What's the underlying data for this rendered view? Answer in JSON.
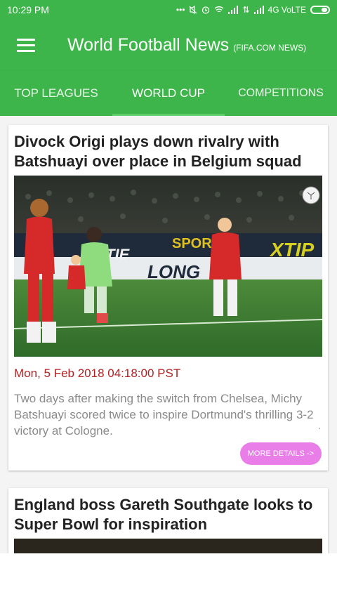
{
  "status_bar": {
    "time": "10:29 PM",
    "network": "4G VoLTE"
  },
  "app_bar": {
    "title": "World Football News",
    "subtitle": "(FIFA.COM NEWS)"
  },
  "tabs": [
    {
      "label": "TOP LEAGUES",
      "active": false
    },
    {
      "label": "WORLD CUP",
      "active": true
    },
    {
      "label": "COMPETITIONS",
      "active": false
    }
  ],
  "articles": [
    {
      "title": "Divock Origi plays down rivalry with Batshuayi over place in Belgium squad",
      "date": "Mon, 5 Feb 2018 04:18:00 PST",
      "excerpt": "Two days after making the switch from Chelsea, Michy Batshuayi scored twice to inspire Dortmund's thrilling 3-2 victory at Cologne.",
      "more_label": "MORE DETAILS ->"
    },
    {
      "title": "England boss Gareth Southgate looks to Super Bowl for inspiration"
    }
  ],
  "photo_text": {
    "board_1": "SPORT",
    "board_2": "XTIP",
    "board_3": "TIE",
    "banner": "LONG"
  },
  "colors": {
    "primary": "#3eb54a",
    "accent": "#e97ee8",
    "date": "#b22222"
  }
}
